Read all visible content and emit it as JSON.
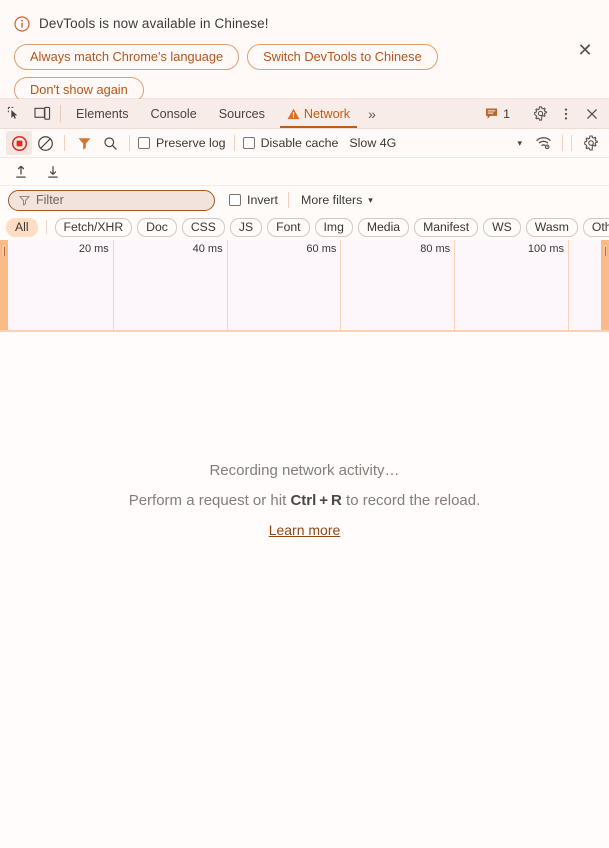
{
  "banner": {
    "icon": "info-circle-icon",
    "message": "DevTools is now available in Chinese!",
    "buttons": [
      {
        "label": "Always match Chrome's language",
        "name": "always-match-language-button"
      },
      {
        "label": "Switch DevTools to Chinese",
        "name": "switch-devtools-chinese-button"
      },
      {
        "label": "Don't show again",
        "name": "dont-show-again-button"
      }
    ],
    "close_label": "✕",
    "accent_color": "#b5551b",
    "border_color": "#dba071"
  },
  "tabbar": {
    "inspect_icon": "inspect-element-icon",
    "device_icon": "device-toolbar-icon",
    "tabs": [
      {
        "label": "Elements",
        "active": false
      },
      {
        "label": "Console",
        "active": false
      },
      {
        "label": "Sources",
        "active": false
      },
      {
        "label": "Network",
        "active": true,
        "warning": true
      }
    ],
    "more_tabs_label": "»",
    "issues_count": "1",
    "issues_icon": "issues-message-icon",
    "settings_icon": "gear-icon",
    "kebab_icon": "more-options-icon",
    "close_icon": "close-devtools-icon",
    "active_color": "#bd5c16"
  },
  "network_toolbar": {
    "record_icon": "record-stop-icon",
    "record_state": "recording",
    "clear_icon": "clear-network-log-icon",
    "filter_icon": "filter-funnel-icon",
    "search_icon": "search-icon",
    "preserve_log": {
      "label": "Preserve log",
      "checked": false
    },
    "disable_cache": {
      "label": "Disable cache",
      "checked": false
    },
    "throttling_value": "Slow 4G",
    "throttling_arrow": "▾",
    "network_conditions_icon": "network-conditions-wifi-icon",
    "settings_icon": "gear-icon"
  },
  "io_row": {
    "import_icon": "import-har-icon",
    "export_icon": "export-har-icon"
  },
  "filter_row": {
    "filter_icon": "filter-funnel-icon",
    "filter_value": "",
    "filter_placeholder": "Filter",
    "invert": {
      "label": "Invert",
      "checked": false
    },
    "more_filters": {
      "label": "More filters",
      "arrow": "▾"
    }
  },
  "type_chips": {
    "items": [
      {
        "label": "All",
        "selected": true
      },
      {
        "label": "Fetch/XHR",
        "selected": false
      },
      {
        "label": "Doc",
        "selected": false
      },
      {
        "label": "CSS",
        "selected": false
      },
      {
        "label": "JS",
        "selected": false
      },
      {
        "label": "Font",
        "selected": false
      },
      {
        "label": "Img",
        "selected": false
      },
      {
        "label": "Media",
        "selected": false
      },
      {
        "label": "Manifest",
        "selected": false
      },
      {
        "label": "WS",
        "selected": false
      },
      {
        "label": "Wasm",
        "selected": false
      },
      {
        "label": "Other",
        "selected": false
      }
    ],
    "selected_bg": "#ffddc4"
  },
  "overview": {
    "ticks": [
      "20 ms",
      "40 ms",
      "60 ms",
      "80 ms",
      "100 ms",
      ""
    ],
    "left_handle": "overview-left-resize-handle",
    "right_handle": "overview-right-resize-handle"
  },
  "empty_state": {
    "title": "Recording network activity…",
    "sub_prefix": "Perform a request or hit ",
    "sub_shortcut": "Ctrl + R",
    "sub_suffix": " to record the reload.",
    "link": "Learn more"
  }
}
